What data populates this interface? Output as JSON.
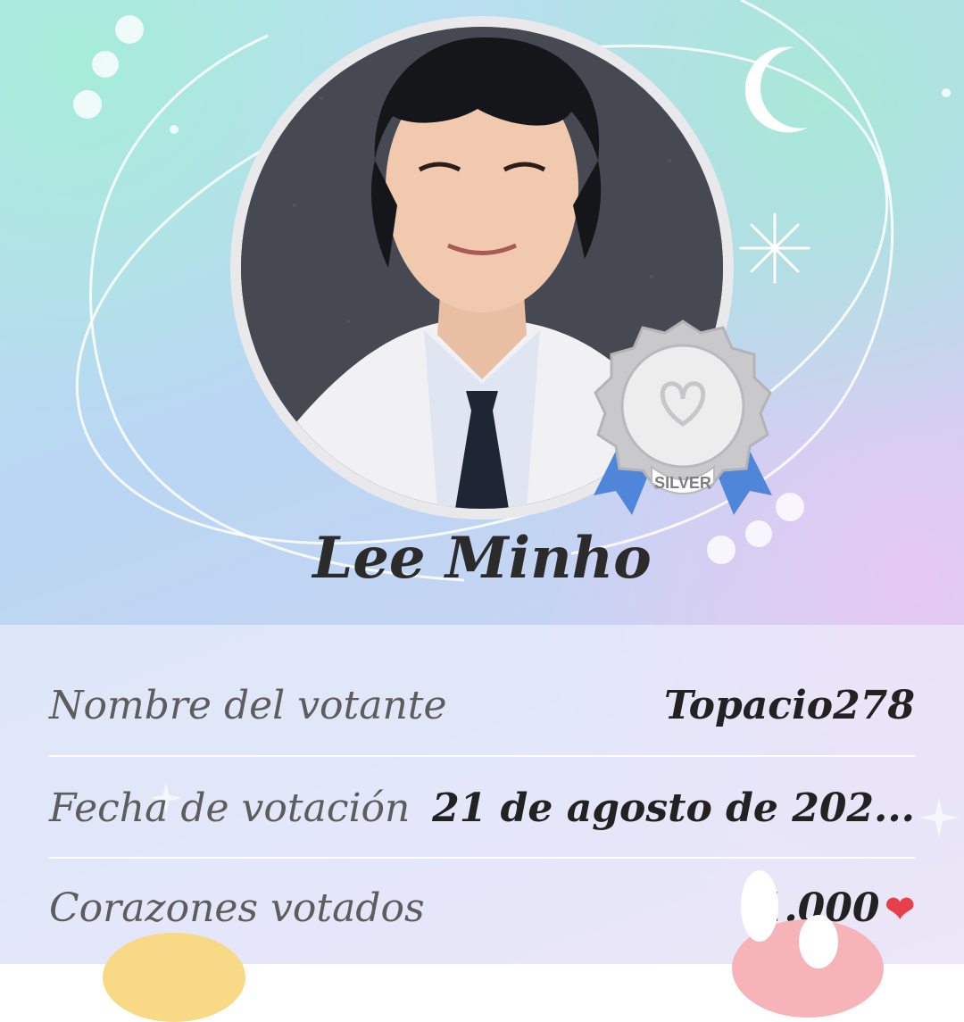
{
  "artist": {
    "name": "Lee Minho"
  },
  "badge": {
    "tier": "SILVER"
  },
  "vote_details": [
    {
      "label": "Nombre del votante",
      "value": "Topacio278"
    },
    {
      "label": "Fecha de votación",
      "value": "21 de agosto de 202..."
    },
    {
      "label": "Corazones votados",
      "value": "1.000"
    }
  ],
  "icons": {
    "heart": "heart-icon",
    "moon": "moon-icon",
    "star": "sparkle-icon"
  },
  "colors": {
    "heart": "#e8404a",
    "ribbon": "#4f86d9",
    "badge_silver": "#c9c9cc"
  }
}
